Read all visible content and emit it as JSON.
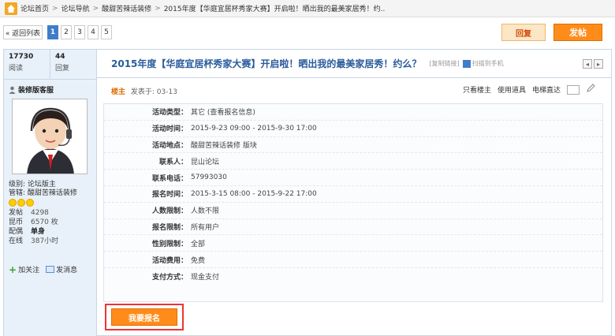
{
  "breadcrumb": [
    "论坛首页",
    "论坛导航",
    "酸甜苦辣话装修",
    "2015年度【华庭宜居杯秀家大赛】开启啦！晒出我的最美家居秀！约.."
  ],
  "pager": {
    "back": "« 返回列表",
    "pages": [
      "1",
      "2",
      "3",
      "4",
      "5"
    ],
    "active": "1"
  },
  "buttons": {
    "reply": "回复",
    "post": "发帖",
    "signup": "我要报名"
  },
  "stats": {
    "views": "17730",
    "views_label": "阅读",
    "replies": "44",
    "replies_label": "回复"
  },
  "author": {
    "name": "装修版客服",
    "level": "级别: 论坛版主",
    "admin": "管辖: 酸甜苦辣话装修",
    "fields": [
      {
        "k": "发帖",
        "v": "4298"
      },
      {
        "k": "昆币",
        "v": "6570 枚"
      },
      {
        "k": "配偶",
        "v": "单身"
      },
      {
        "k": "在线",
        "v": "387小时"
      }
    ],
    "follow": "加关注",
    "message": "发消息"
  },
  "post": {
    "title": "2015年度【华庭宜居杯秀家大赛】开启啦！晒出我的最美家居秀！约么？",
    "copy_link": "[复制链接]",
    "qr_text": "扫描到手机",
    "floor": "楼主",
    "posted": "发表于: 03-13",
    "tools": [
      "只看楼主",
      "使用道具",
      "电梯直达"
    ]
  },
  "activity": [
    {
      "k": "活动类型：",
      "v": "其它 (查看报名信息)"
    },
    {
      "k": "活动时间：",
      "v": "2015-9-23 09:00 - 2015-9-30 17:00"
    },
    {
      "k": "活动地点：",
      "v": "酸甜苦辣话装修 版块"
    },
    {
      "k": "联系人：",
      "v": "昆山论坛"
    },
    {
      "k": "联系电话：",
      "v": "57993030"
    },
    {
      "k": "报名时间：",
      "v": "2015-3-15 08:00 - 2015-9-22 17:00"
    },
    {
      "k": "人数限制：",
      "v": "人数不限"
    },
    {
      "k": "报名限制：",
      "v": "所有用户"
    },
    {
      "k": "性别限制：",
      "v": "全部"
    },
    {
      "k": "活动费用：",
      "v": "免费"
    },
    {
      "k": "支付方式：",
      "v": "现金支付"
    }
  ],
  "icons": {
    "home": "home-icon",
    "user": "user-icon",
    "qr": "qr-icon",
    "pen": "pen-icon",
    "plus": "plus-icon",
    "message": "message-icon"
  }
}
